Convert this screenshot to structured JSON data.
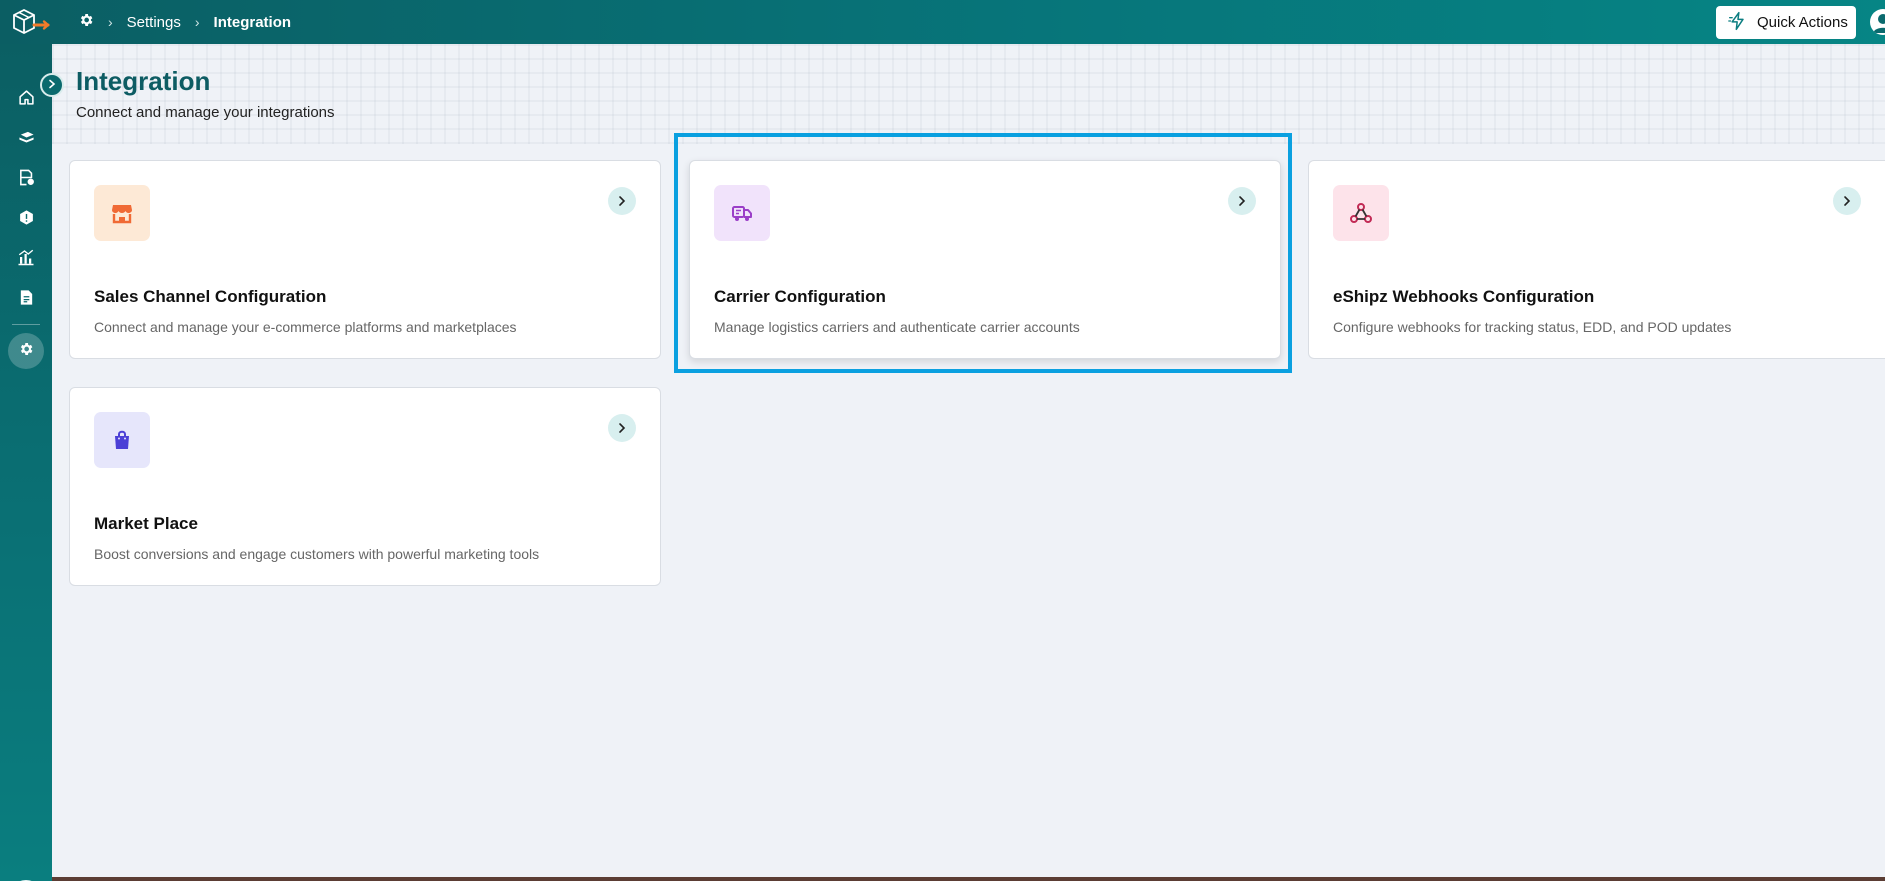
{
  "breadcrumb": {
    "items": [
      "Settings",
      "Integration"
    ]
  },
  "header": {
    "quick_actions_label": "Quick Actions"
  },
  "page": {
    "title": "Integration",
    "subtitle": "Connect and manage your integrations"
  },
  "cards": [
    {
      "title": "Sales Channel Configuration",
      "description": "Connect and manage your e-commerce platforms and marketplaces",
      "icon": "storefront-icon"
    },
    {
      "title": "Carrier Configuration",
      "description": "Manage logistics carriers and authenticate carrier accounts",
      "icon": "delivery-truck-icon"
    },
    {
      "title": "eShipz Webhooks Configuration",
      "description": "Configure webhooks for tracking status, EDD, and POD updates",
      "icon": "webhook-icon"
    },
    {
      "title": "Market Place",
      "description": "Boost conversions and engage customers with powerful marketing tools",
      "icon": "shopping-bag-icon"
    }
  ],
  "colors": {
    "brand": "#0b6a6e",
    "highlight": "#0aa0e0",
    "store_bg": "#fde9d6",
    "store_icon": "#f06a35",
    "truck_bg": "#f1e3fb",
    "truck_icon": "#9b3ec8",
    "webhook_bg": "#fde3ea",
    "webhook_icon": "#c22a55",
    "bag_bg": "#e6e6fb",
    "bag_icon": "#4b3fd6"
  }
}
